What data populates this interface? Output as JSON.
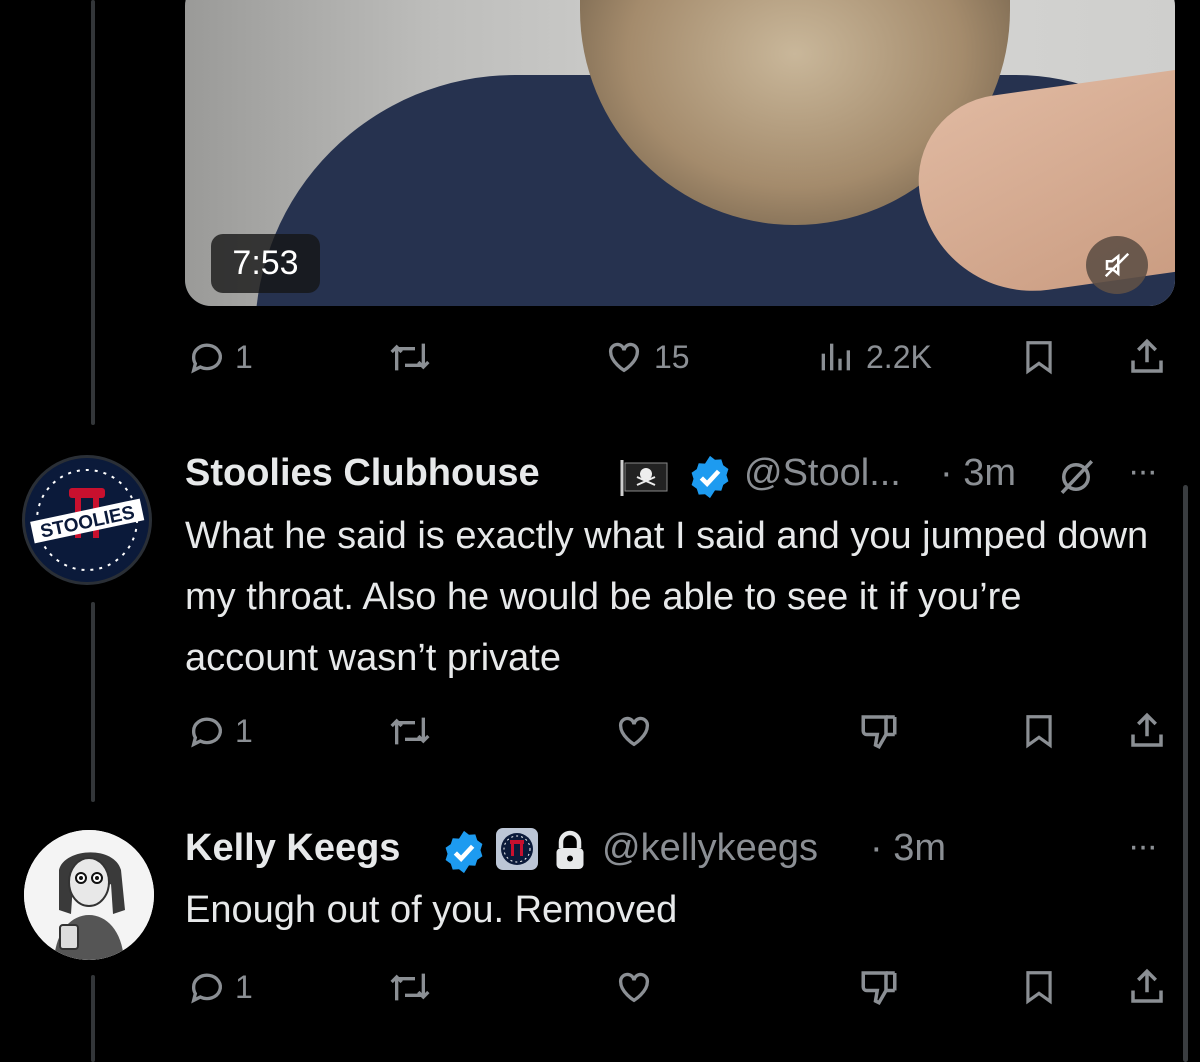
{
  "tweet1": {
    "video_duration": "7:53",
    "replies": "1",
    "likes": "15",
    "views": "2.2K",
    "icons": [
      "reply-icon",
      "retweet-icon",
      "like-icon",
      "views-icon",
      "bookmark-icon",
      "share-icon",
      "mute-icon"
    ]
  },
  "tweet2": {
    "display_name": "Stoolies Clubhouse",
    "avatar_text": "STOOLIES",
    "handle": "@Stool...",
    "time": "· 3m",
    "text": "What he said is exactly what I said and you jumped down my throat. Also he would be able to see it if you’re account wasn’t private",
    "replies": "1",
    "more": "···",
    "icons": [
      "pirate-flag-icon",
      "verified-badge-icon",
      "grok-icon",
      "reply-icon",
      "retweet-icon",
      "like-icon",
      "dislike-icon",
      "bookmark-icon",
      "share-icon"
    ]
  },
  "tweet3": {
    "display_name": "Kelly Keegs",
    "handle": "@kellykeegs",
    "time": "· 3m",
    "text": "Enough out of you. Removed",
    "replies": "1",
    "more": "···",
    "icons": [
      "verified-badge-icon",
      "barstool-badge-icon",
      "lock-icon",
      "reply-icon",
      "retweet-icon",
      "like-icon",
      "dislike-icon",
      "bookmark-icon",
      "share-icon"
    ]
  },
  "colors": {
    "background": "#000000",
    "text": "#e7e9ea",
    "secondary": "#8b8f94",
    "verified": "#1d9bf0"
  }
}
